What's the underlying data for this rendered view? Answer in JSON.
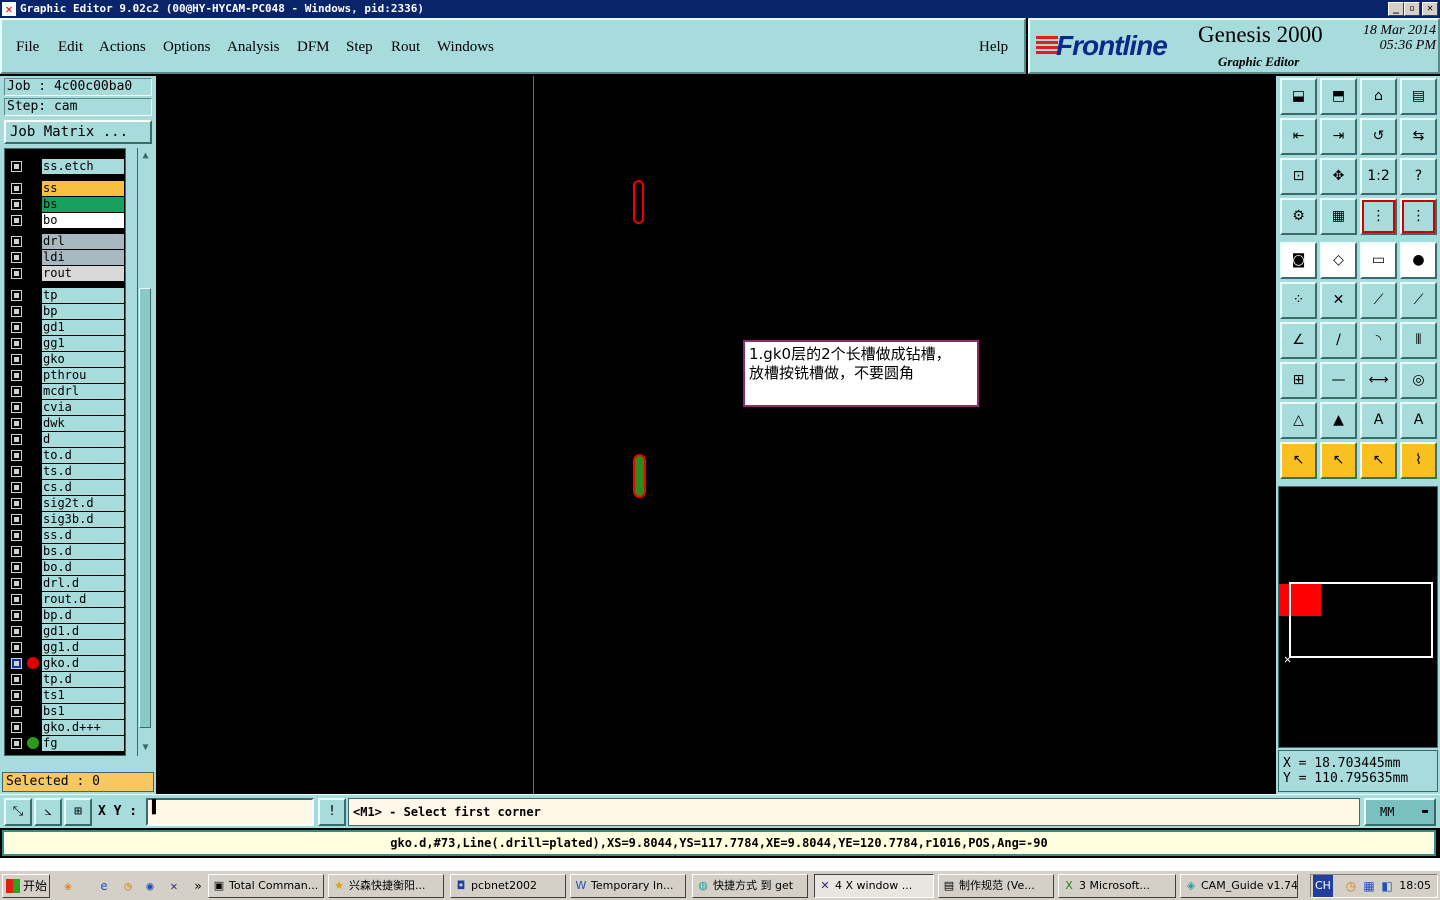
{
  "window": {
    "title": "Graphic Editor 9.02c2 (00@HY-HYCAM-PC048 - Windows, pid:2336)",
    "minimize": "_",
    "maximize": "▫",
    "close": "✕"
  },
  "menu": {
    "items": [
      "File",
      "Edit",
      "Actions",
      "Options",
      "Analysis",
      "DFM",
      "Step",
      "Rout",
      "Windows"
    ],
    "help": "Help"
  },
  "brand": {
    "logo": "Frontline",
    "product": "Genesis 2000",
    "subtitle": "Graphic Editor",
    "date": "18 Mar 2014",
    "time": "05:36 PM",
    "logo_color": "#0a2a8a",
    "accent": "#e0201a"
  },
  "left": {
    "job": "Job : 4c00c00ba0",
    "step": "Step: cam",
    "job_matrix": "Job Matrix ...",
    "selected": "Selected : 0",
    "layers": [
      {
        "name": "ss.etch",
        "color": "#a8dcdc"
      },
      {
        "name": "ss",
        "color": "#f8c040"
      },
      {
        "name": "bs",
        "color": "#18a060"
      },
      {
        "name": "bo",
        "color": "#ffffff"
      },
      {
        "name": "drl",
        "color": "#a8b8c0"
      },
      {
        "name": "ldi",
        "color": "#a8b8c0"
      },
      {
        "name": "rout",
        "color": "#d8d8d8"
      },
      {
        "name": "tp",
        "color": "#a8dcdc"
      },
      {
        "name": "bp",
        "color": "#a8dcdc"
      },
      {
        "name": "gd1",
        "color": "#a8dcdc"
      },
      {
        "name": "gg1",
        "color": "#a8dcdc"
      },
      {
        "name": "gko",
        "color": "#a8dcdc"
      },
      {
        "name": "pthrou",
        "color": "#a8dcdc"
      },
      {
        "name": "mcdrl",
        "color": "#a8dcdc"
      },
      {
        "name": "cvia",
        "color": "#a8dcdc"
      },
      {
        "name": "dwk",
        "color": "#a8dcdc"
      },
      {
        "name": "d",
        "color": "#a8dcdc"
      },
      {
        "name": "to.d",
        "color": "#a8dcdc"
      },
      {
        "name": "ts.d",
        "color": "#a8dcdc"
      },
      {
        "name": "cs.d",
        "color": "#a8dcdc"
      },
      {
        "name": "sig2t.d",
        "color": "#a8dcdc"
      },
      {
        "name": "sig3b.d",
        "color": "#a8dcdc"
      },
      {
        "name": "ss.d",
        "color": "#a8dcdc"
      },
      {
        "name": "bs.d",
        "color": "#a8dcdc"
      },
      {
        "name": "bo.d",
        "color": "#a8dcdc"
      },
      {
        "name": "drl.d",
        "color": "#a8dcdc"
      },
      {
        "name": "rout.d",
        "color": "#a8dcdc"
      },
      {
        "name": "bp.d",
        "color": "#a8dcdc"
      },
      {
        "name": "gd1.d",
        "color": "#a8dcdc"
      },
      {
        "name": "gg1.d",
        "color": "#a8dcdc"
      },
      {
        "name": "gko.d",
        "color": "#a8dcdc",
        "dot": "#e00000",
        "active": true
      },
      {
        "name": "tp.d",
        "color": "#a8dcdc"
      },
      {
        "name": "ts1",
        "color": "#a8dcdc"
      },
      {
        "name": "bs1",
        "color": "#a8dcdc"
      },
      {
        "name": "gko.d+++",
        "color": "#a8dcdc"
      },
      {
        "name": "fg",
        "color": "#a8dcdc",
        "dot": "#2a9a1a"
      }
    ]
  },
  "canvas": {
    "note_line1": "1.gk0层的2个长槽做成钻槽，",
    "note_line2": "放槽按铣槽做，不要圆角"
  },
  "right": {
    "coord_x": "X  =  18.703445mm",
    "coord_y": "Y  =  110.795635mm"
  },
  "cmd": {
    "xy_label": "X Y :",
    "xy_value": "▌",
    "prompt": "<M1> - Select first corner",
    "units": "MM",
    "alert_icon": "!"
  },
  "status": {
    "text": "gko.d,#73,Line(.drill=plated),XS=9.8044,YS=117.7784,XE=9.8044,YE=120.7784,r1016,POS,Ang=-90"
  },
  "taskbar": {
    "start": "开始",
    "tasks": [
      "Total Comman...",
      "兴森快捷衡阳...",
      "pcbnet2002",
      "Temporary In...",
      "快捷方式 到 get",
      "4 X window ...",
      "制作规范 (Ve...",
      "3 Microsoft...",
      "CAM_Guide v1.74"
    ],
    "clock": "18:05",
    "lang": "CH"
  }
}
